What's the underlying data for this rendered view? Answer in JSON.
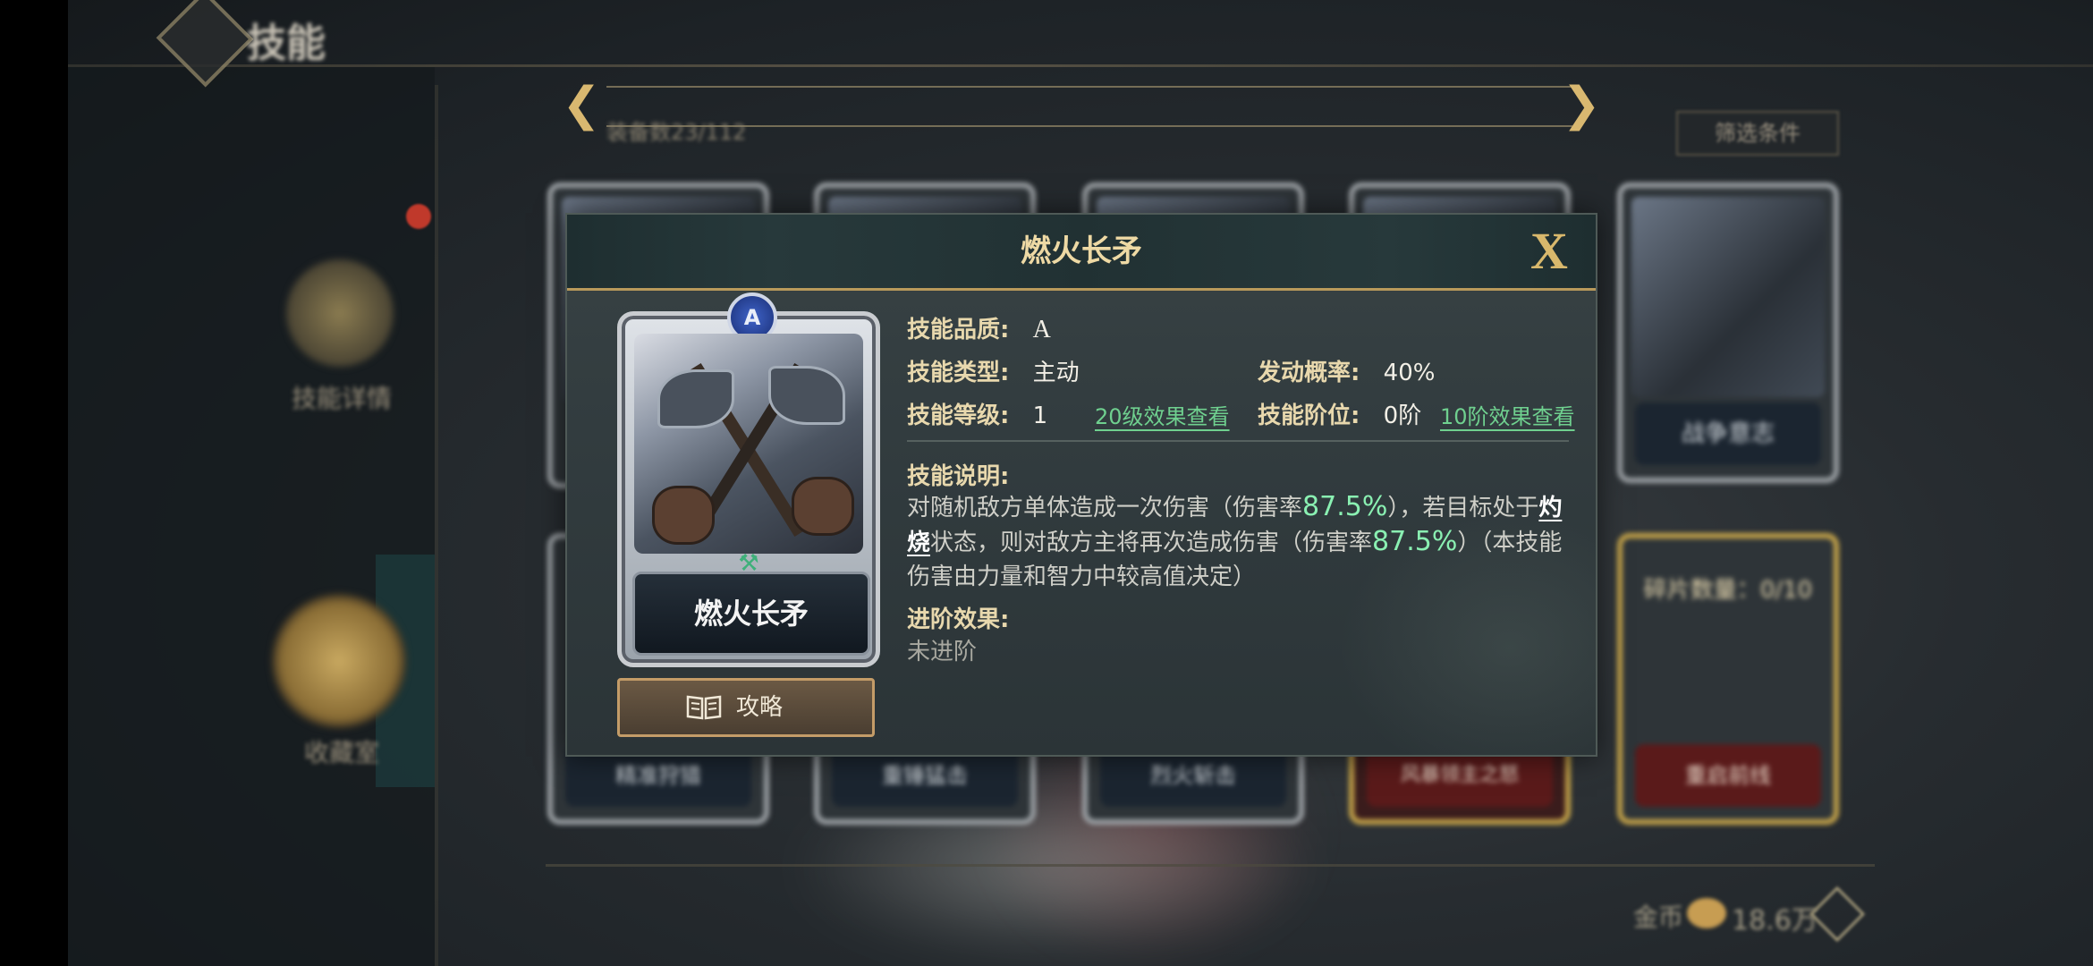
{
  "background": {
    "header_title": "技能",
    "sub_text": "装备数23/112",
    "filter_label": "筛选条件",
    "left_menu": [
      {
        "label": "技能详情"
      },
      {
        "label": "收藏室"
      }
    ],
    "cards": [
      {
        "label": "战争意志"
      },
      {
        "label": "精准狩猎"
      },
      {
        "label": "重锤猛击"
      },
      {
        "label": "烈火斩击"
      },
      {
        "label": "风暴领主之怒"
      },
      {
        "label": "碎片数量：0/10"
      },
      {
        "label": "重启前线"
      }
    ],
    "currency_label": "金币",
    "currency_amount": "18.6万"
  },
  "modal": {
    "title": "燃火长矛",
    "close_label": "X",
    "card": {
      "quality_badge": "A",
      "name": "燃火长矛"
    },
    "guide_button": "攻略",
    "fields": {
      "quality_label": "技能品质:",
      "quality_value": "A",
      "type_label": "技能类型:",
      "type_value": "主动",
      "trigger_label": "发动概率:",
      "trigger_value": "40%",
      "level_label": "技能等级:",
      "level_value": "1",
      "level_link": "20级效果查看",
      "stage_label": "技能阶位:",
      "stage_value": "0阶",
      "stage_link": "10阶效果查看"
    },
    "description": {
      "label": "技能说明:",
      "part1": "对随机敌方单体造成一次伤害（伤害率",
      "rate1": "87.5%",
      "part2": "），若目标处于",
      "keyword": "灼烧",
      "part3": "状态，则对敌方主将再次造成伤害（伤害率",
      "rate2": "87.5%",
      "part4": "）（本技能伤害由力量和智力中较高值决定）"
    },
    "advance": {
      "label": "进阶效果:",
      "value": "未进阶"
    }
  },
  "colors": {
    "accent_gold": "#d8b86c",
    "highlight_green": "#8af0b2",
    "link_green": "#6fd08f"
  }
}
